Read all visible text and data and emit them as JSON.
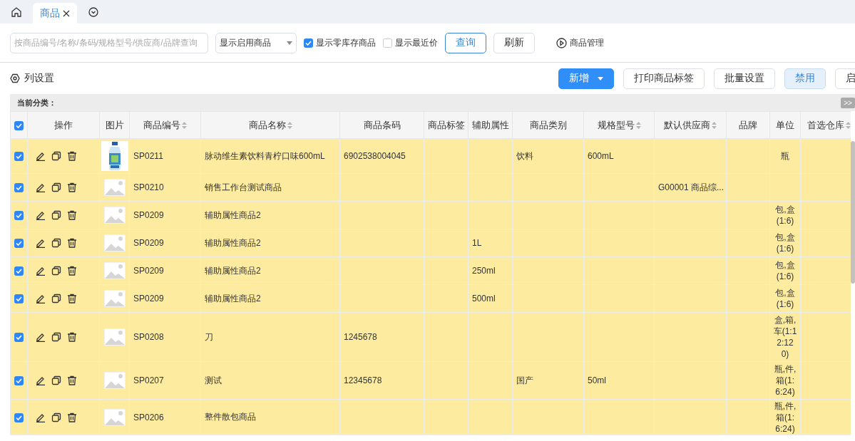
{
  "tabs": [
    {
      "label": "商品",
      "selected": true
    }
  ],
  "filters": {
    "search": {
      "placeholder": "按商品编号/名称/条码/规格型号/供应商/品牌查询"
    },
    "status_select": {
      "value": "显示启用商品"
    },
    "checkboxes": [
      {
        "label": "显示零库存商品",
        "checked": true
      },
      {
        "label": "显示最近价",
        "checked": false
      }
    ],
    "buttons": [
      {
        "label": "查询",
        "kind": "outline-primary"
      },
      {
        "label": "刷新",
        "kind": "default"
      }
    ],
    "link": "商品管理"
  },
  "column_settings": "列设置",
  "actions": [
    {
      "label": "新增",
      "kind": "primary-split"
    },
    {
      "label": "打印商品标签",
      "kind": "default"
    },
    {
      "label": "批量设置",
      "kind": "default"
    },
    {
      "label": "禁用",
      "kind": "light"
    },
    {
      "label": "启",
      "kind": "default"
    }
  ],
  "category_bar": {
    "label": "当前分类：",
    "toggle": ">>"
  },
  "table": {
    "select_all": true,
    "columns": [
      {
        "label": "操作",
        "sortable": false
      },
      {
        "label": "图片",
        "sortable": false
      },
      {
        "label": "商品编号",
        "sortable": true
      },
      {
        "label": "商品名称",
        "sortable": true
      },
      {
        "label": "商品条码",
        "sortable": false
      },
      {
        "label": "商品标签",
        "sortable": false
      },
      {
        "label": "辅助属性",
        "sortable": false
      },
      {
        "label": "商品类别",
        "sortable": false
      },
      {
        "label": "规格型号",
        "sortable": true
      },
      {
        "label": "默认供应商",
        "sortable": true
      },
      {
        "label": "品牌",
        "sortable": false
      },
      {
        "label": "单位",
        "sortable": false
      },
      {
        "label": "首选仓库",
        "sortable": true
      }
    ],
    "rows": [
      {
        "checked": true,
        "code": "SP0211",
        "name": "脉动维生素饮料青柠口味600mL",
        "barcode": "6902538004045",
        "category": "饮料",
        "spec": "600mL",
        "unit": "瓶"
      },
      {
        "checked": true,
        "kind": "placeholder",
        "code": "SP0210",
        "name": "销售工作台测试商品",
        "supplier": "G00001 商品综..."
      },
      {
        "checked": true,
        "kind": "placeholder",
        "code": "SP0209",
        "name": "辅助属性商品2",
        "unit": "包,盒(1:6)"
      },
      {
        "checked": true,
        "kind": "placeholder",
        "code": "SP0209",
        "name": "辅助属性商品2",
        "attr": "1L",
        "unit": "包,盒(1:6)"
      },
      {
        "checked": true,
        "kind": "placeholder",
        "code": "SP0209",
        "name": "辅助属性商品2",
        "attr": "250ml",
        "unit": "包,盒(1:6)"
      },
      {
        "checked": true,
        "kind": "placeholder",
        "code": "SP0209",
        "name": "辅助属性商品2",
        "attr": "500ml",
        "unit": "包,盒(1:6)"
      },
      {
        "checked": true,
        "kind": "placeholder",
        "code": "SP0208",
        "name": "刀",
        "barcode": "1245678",
        "unit": "盒,箱,车(1:12:120)"
      },
      {
        "checked": true,
        "kind": "placeholder",
        "code": "SP0207",
        "name": "测试",
        "barcode": "12345678",
        "category": "国产",
        "spec": "50ml",
        "unit": "瓶,件,箱(1:6:24)"
      },
      {
        "checked": true,
        "kind": "placeholder",
        "code": "SP0206",
        "name": "整件散包商品",
        "unit": "瓶,件,箱(1:6:24)"
      }
    ]
  }
}
